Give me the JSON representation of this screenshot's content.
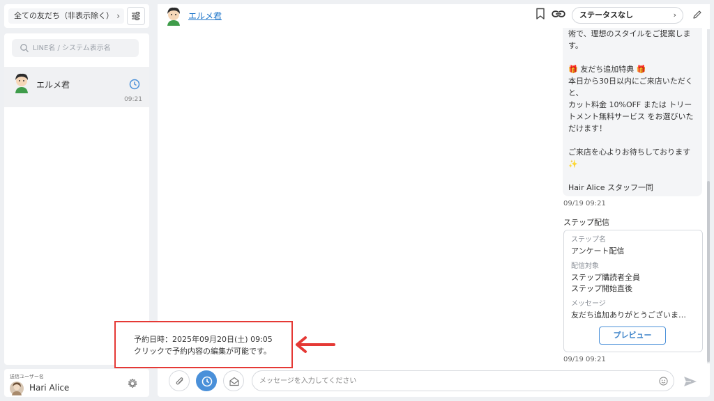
{
  "sidebar": {
    "filter_label": "全ての友だち（非表示除く）",
    "search_placeholder": "LINE名 / システム表示名",
    "friends": [
      {
        "name": "エルメ君",
        "time": "09:21"
      }
    ],
    "sender_label": "送信ユーザー名",
    "sender_name": "Hari Alice"
  },
  "header": {
    "friend_name": "エルメ君",
    "status": "ステータスなし"
  },
  "chat": {
    "message_lines": [
      "術で、理想のスタイルをご提案しま",
      "す。",
      "",
      "🎁 友だち追加特典 🎁",
      "本日から30日以内にご来店いただく",
      "と、",
      "カット料金 10%OFF または トリー",
      "トメント無料サービス をお選びいた",
      "だけます！",
      "",
      "ご来店を心よりお待ちしております",
      "✨",
      "",
      "Hair Alice スタッフ一同"
    ],
    "message_time": "09/19 09:21",
    "step_label": "ステップ配信",
    "step_card": {
      "name_key": "ステップ名",
      "name_value": "アンケート配信",
      "target_key": "配信対象",
      "target_value_1": "ステップ購読者全員",
      "target_value_2": "ステップ開始直後",
      "message_key": "メッセージ",
      "message_value": "友だち追加ありがとうございま…",
      "preview_label": "プレビュー"
    },
    "step_time": "09/19 09:21"
  },
  "composer": {
    "placeholder": "メッセージを入力してください"
  },
  "tooltip": {
    "line1": "予約日時：2025年09月20日(土) 09:05",
    "line2": "クリックで予約内容の編集が可能です。"
  },
  "colors": {
    "accent": "#4a90d9",
    "annotation": "#e53935",
    "link": "#1a73c9"
  }
}
